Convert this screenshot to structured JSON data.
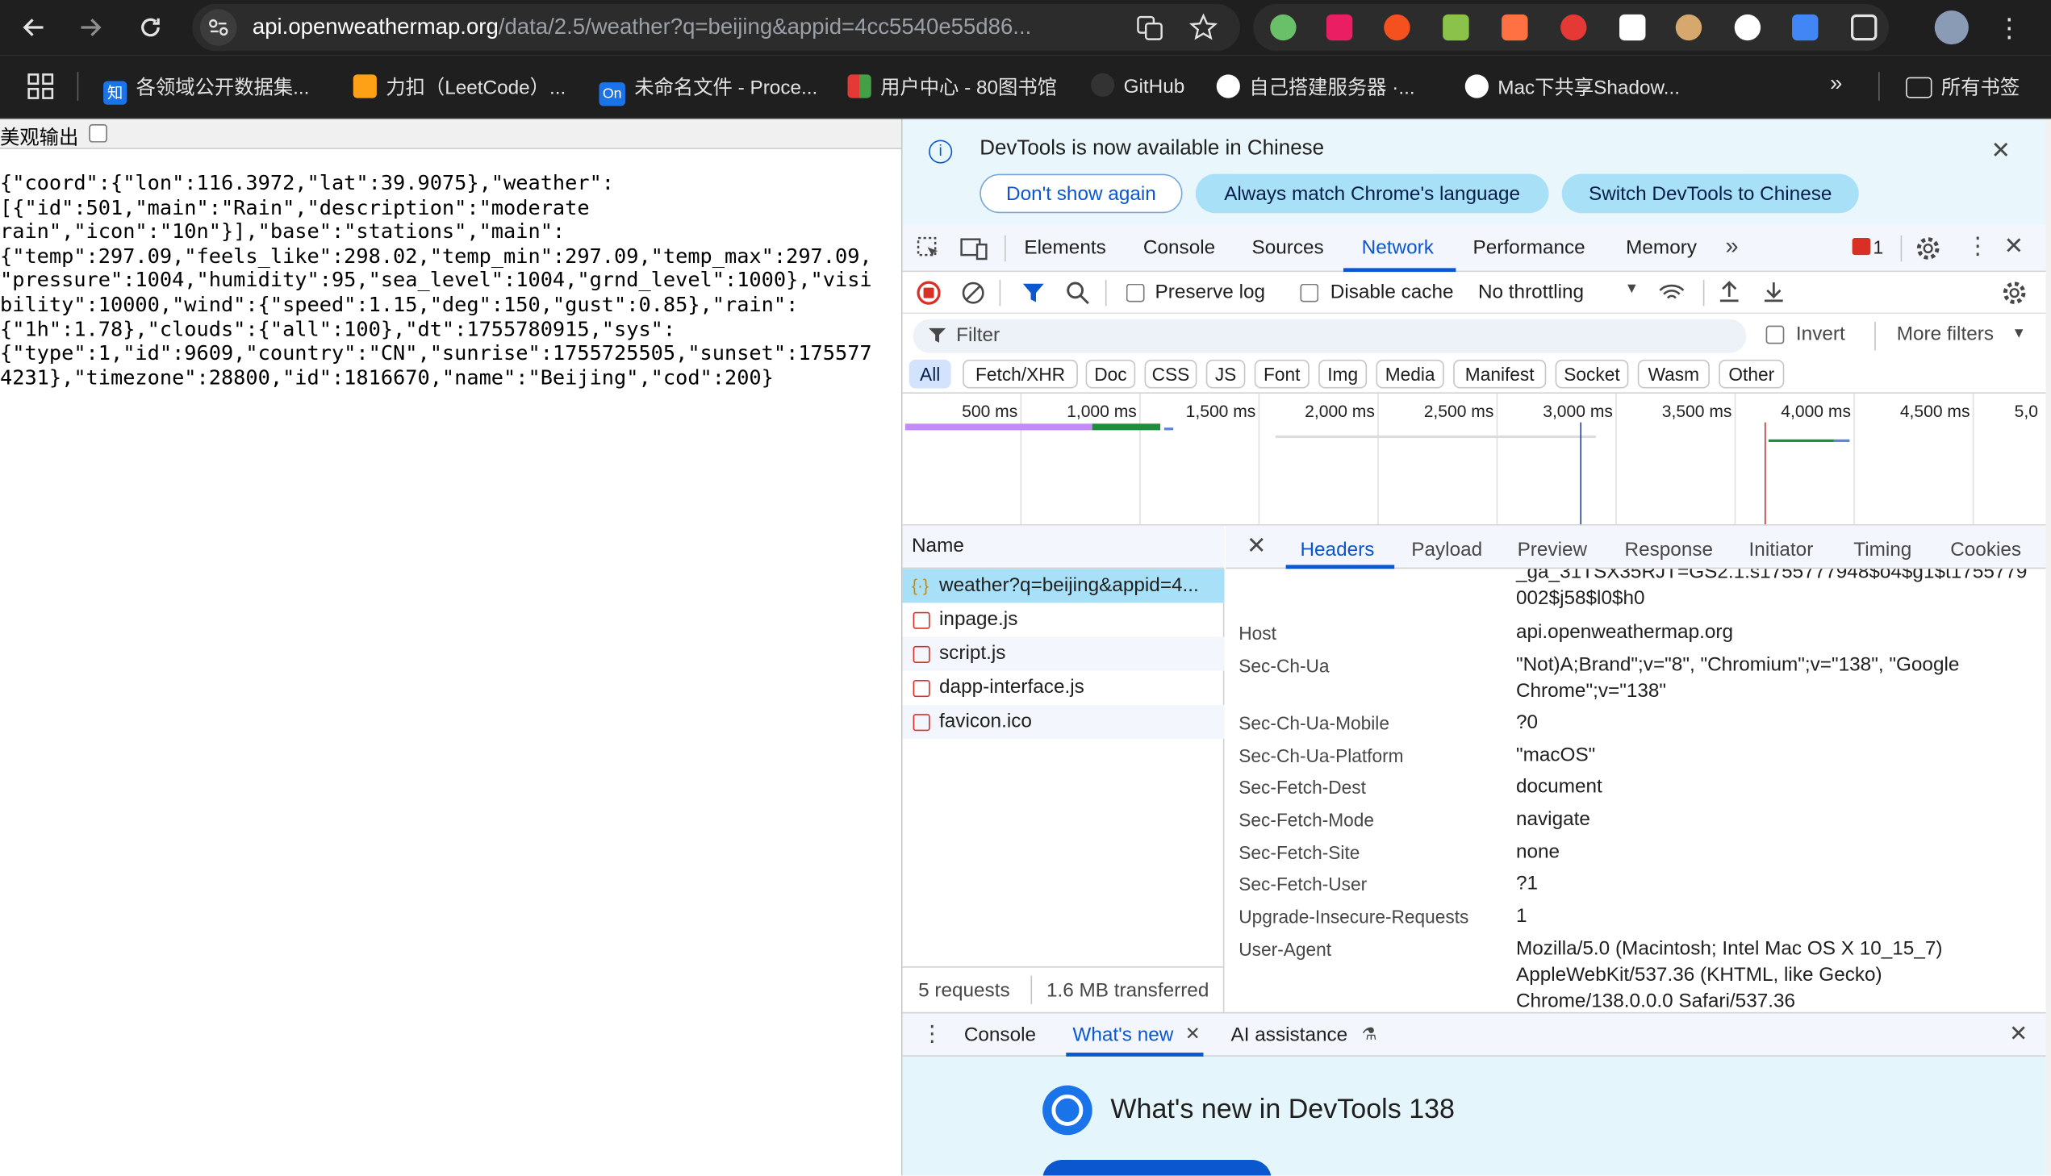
{
  "browser": {
    "url_host": "api.openweathermap.org",
    "url_path": "/data/2.5/weather?q=beijing&appid=4cc5540e55d86..."
  },
  "bookmarks": [
    {
      "label": "各领域公开数据集...",
      "icon_text": "知",
      "color": "#1a73e8"
    },
    {
      "label": "力扣（LeetCode）...",
      "icon_text": "",
      "color": "#ffa116"
    },
    {
      "label": "未命名文件 - Proce...",
      "icon_text": "On",
      "color": "#1a73e8"
    },
    {
      "label": "用户中心 - 80图书馆",
      "icon_text": "",
      "color": "#e53935"
    },
    {
      "label": "GitHub",
      "icon_text": "",
      "color": "#333333"
    },
    {
      "label": "自己搭建服务器 ·...",
      "icon_text": "",
      "color": "#ffffff"
    },
    {
      "label": "Mac下共享Shadow...",
      "icon_text": "",
      "color": "#ffffff"
    }
  ],
  "bookmarks_folder": "所有书签",
  "page": {
    "pretty_print_label": "美观输出",
    "json_text": "{\"coord\":{\"lon\":116.3972,\"lat\":39.9075},\"weather\":\n[{\"id\":501,\"main\":\"Rain\",\"description\":\"moderate\nrain\",\"icon\":\"10n\"}],\"base\":\"stations\",\"main\":\n{\"temp\":297.09,\"feels_like\":298.02,\"temp_min\":297.09,\"temp_max\":297.09,\n\"pressure\":1004,\"humidity\":95,\"sea_level\":1004,\"grnd_level\":1000},\"visi\nbility\":10000,\"wind\":{\"speed\":1.15,\"deg\":150,\"gust\":0.85},\"rain\":\n{\"1h\":1.78},\"clouds\":{\"all\":100},\"dt\":1755780915,\"sys\":\n{\"type\":1,\"id\":9609,\"country\":\"CN\",\"sunrise\":1755725505,\"sunset\":175577\n4231},\"timezone\":28800,\"id\":1816670,\"name\":\"Beijing\",\"cod\":200}"
  },
  "devtools": {
    "infobar_text": "DevTools is now available in Chinese",
    "infobar_buttons": [
      "Don't show again",
      "Always match Chrome's language",
      "Switch DevTools to Chinese"
    ],
    "panel_tabs": [
      "Elements",
      "Console",
      "Sources",
      "Network",
      "Performance",
      "Memory"
    ],
    "active_panel": "Network",
    "error_count": "1",
    "preserve_log": "Preserve log",
    "disable_cache": "Disable cache",
    "throttling": "No throttling",
    "filter_placeholder": "Filter",
    "invert": "Invert",
    "more_filters": "More filters",
    "type_filters": [
      "All",
      "Fetch/XHR",
      "Doc",
      "CSS",
      "JS",
      "Font",
      "Img",
      "Media",
      "Manifest",
      "Socket",
      "Wasm",
      "Other"
    ],
    "timeline_ticks": [
      "500 ms",
      "1,000 ms",
      "1,500 ms",
      "2,000 ms",
      "2,500 ms",
      "3,000 ms",
      "3,500 ms",
      "4,000 ms",
      "4,500 ms",
      "5,0"
    ],
    "name_header": "Name",
    "requests": [
      "weather?q=beijing&appid=4...",
      "inpage.js",
      "script.js",
      "dapp-interface.js",
      "favicon.ico"
    ],
    "summary_requests": "5 requests",
    "summary_transferred": "1.6 MB transferred",
    "detail_tabs": [
      "Headers",
      "Payload",
      "Preview",
      "Response",
      "Initiator",
      "Timing",
      "Cookies"
    ],
    "cookie_tail": "_ga_31TSX35RJT=GS2.1.s1755777948$o4$g1$t1755779002$j58$l0$h0",
    "headers": [
      {
        "key": "Host",
        "value": "api.openweathermap.org"
      },
      {
        "key": "Sec-Ch-Ua",
        "value": "\"Not)A;Brand\";v=\"8\", \"Chromium\";v=\"138\", \"Google Chrome\";v=\"138\""
      },
      {
        "key": "Sec-Ch-Ua-Mobile",
        "value": "?0"
      },
      {
        "key": "Sec-Ch-Ua-Platform",
        "value": "\"macOS\""
      },
      {
        "key": "Sec-Fetch-Dest",
        "value": "document"
      },
      {
        "key": "Sec-Fetch-Mode",
        "value": "navigate"
      },
      {
        "key": "Sec-Fetch-Site",
        "value": "none"
      },
      {
        "key": "Sec-Fetch-User",
        "value": "?1"
      },
      {
        "key": "Upgrade-Insecure-Requests",
        "value": "1"
      },
      {
        "key": "User-Agent",
        "value": "Mozilla/5.0 (Macintosh; Intel Mac OS X 10_15_7) AppleWebKit/537.36 (KHTML, like Gecko) Chrome/138.0.0.0 Safari/537.36"
      }
    ],
    "drawer_tabs": [
      "Console",
      "What's new",
      "AI assistance"
    ],
    "whats_new_title": "What's new in DevTools 138"
  }
}
